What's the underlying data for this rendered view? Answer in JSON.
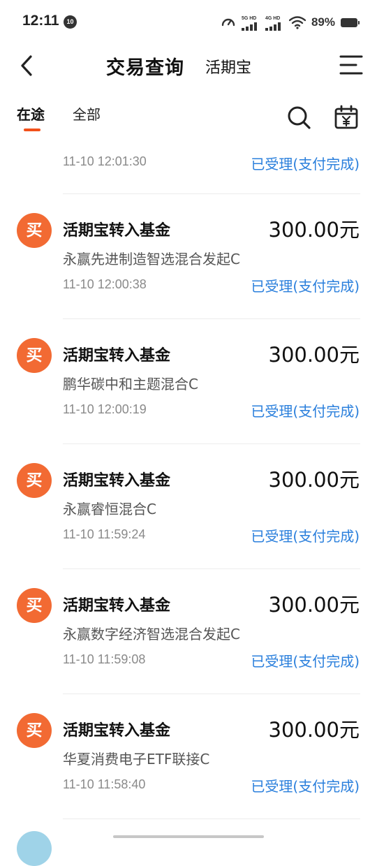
{
  "status_bar": {
    "time": "12:11",
    "badge": "10",
    "sig1_label": "5G HD",
    "sig2_label": "4G HD",
    "battery": "89%"
  },
  "header": {
    "back_icon": "chevron-left-icon",
    "title": "交易查询",
    "subtitle": "活期宝",
    "menu_icon": "menu-icon"
  },
  "tabs": {
    "active": "在途",
    "all": "全部",
    "search_icon": "search-icon",
    "calendar_icon": "calendar-yen-icon"
  },
  "colors": {
    "accent": "#f2511b",
    "buy_icon_bg": "#f26a33",
    "status_blue": "#2a7fdc"
  },
  "partial_item": {
    "time": "11-10 12:01:30",
    "status": "已受理(支付完成)"
  },
  "items": [
    {
      "icon_text": "买",
      "title": "活期宝转入基金",
      "amount": "300.00元",
      "fund": "永赢先进制造智选混合发起C",
      "time": "11-10 12:00:38",
      "status": "已受理(支付完成)"
    },
    {
      "icon_text": "买",
      "title": "活期宝转入基金",
      "amount": "300.00元",
      "fund": "鹏华碳中和主题混合C",
      "time": "11-10 12:00:19",
      "status": "已受理(支付完成)"
    },
    {
      "icon_text": "买",
      "title": "活期宝转入基金",
      "amount": "300.00元",
      "fund": "永赢睿恒混合C",
      "time": "11-10 11:59:24",
      "status": "已受理(支付完成)"
    },
    {
      "icon_text": "买",
      "title": "活期宝转入基金",
      "amount": "300.00元",
      "fund": "永赢数字经济智选混合发起C",
      "time": "11-10 11:59:08",
      "status": "已受理(支付完成)"
    },
    {
      "icon_text": "买",
      "title": "活期宝转入基金",
      "amount": "300.00元",
      "fund": "华夏消费电子ETF联接C",
      "time": "11-10 11:58:40",
      "status": "已受理(支付完成)"
    }
  ]
}
